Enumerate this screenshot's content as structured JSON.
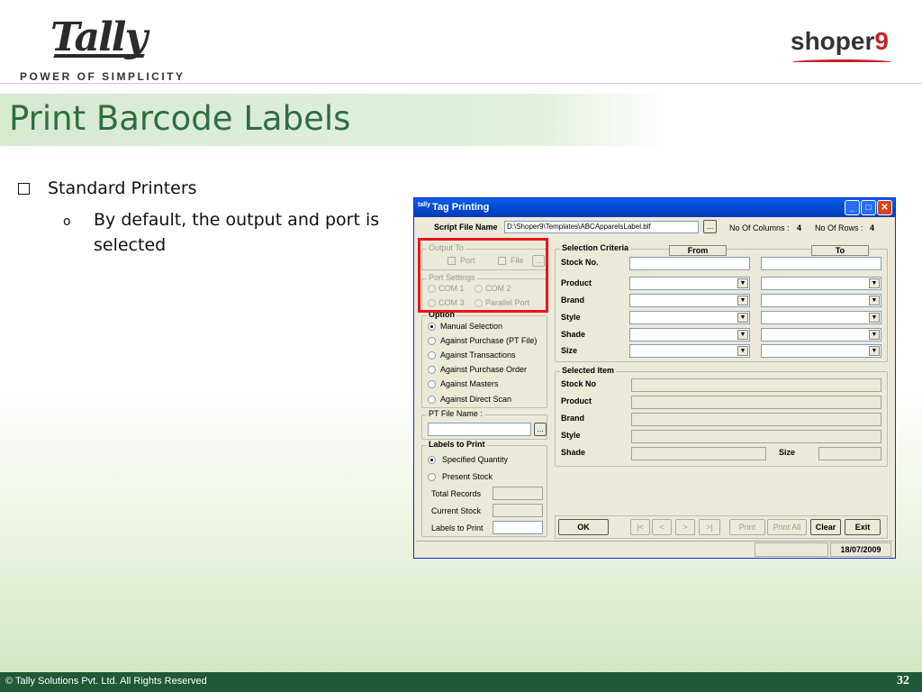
{
  "header": {
    "brand_tagline": "POWER OF SIMPLICITY",
    "page_title": "Print Barcode Labels",
    "colors": {
      "title": "#2e6e43",
      "footer_bg": "#1f5937",
      "highlight": "#e8161b"
    }
  },
  "bullets": {
    "level1": "Standard Printers",
    "level2": "By default, the output and port is selected"
  },
  "footer": {
    "copyright": "© Tally Solutions Pvt. Ltd. All Rights Reserved",
    "page_number": "32"
  },
  "dialog": {
    "title": "Tag Printing",
    "title_icon_text": "tally",
    "script_label": "Script File Name",
    "script_value": "D:\\Shoper9\\Templates\\ABCApparelsLabel.blf",
    "browse_label": "...",
    "columns_label": "No Of Columns :",
    "columns_value": "4",
    "rows_label": "No Of Rows :",
    "rows_value": "4",
    "output_to": {
      "caption": "Output To",
      "port": "Port",
      "file": "File"
    },
    "port_settings": {
      "caption": "Port Settings",
      "com1": "COM 1",
      "com2": "COM 2",
      "com3": "COM 3",
      "parallel": "Parallel Port"
    },
    "option": {
      "caption": "Option",
      "items": [
        "Manual Selection",
        "Against Purchase (PT File)",
        "Against Transactions",
        "Against Purchase Order",
        "Against Masters",
        "Against Direct Scan"
      ],
      "selected": "Manual Selection"
    },
    "pt_file_label": "PT File Name :",
    "labels_to_print": {
      "caption": "Labels to Print",
      "specified": "Specified Quantity",
      "present": "Present Stock",
      "total_records": "Total Records",
      "current_stock": "Current Stock",
      "labels_to_print": "Labels to Print"
    },
    "selection": {
      "caption": "Selection Criteria",
      "from": "From",
      "to": "To",
      "stock_no": "Stock No.",
      "product": "Product",
      "brand": "Brand",
      "style": "Style",
      "shade": "Shade",
      "size": "Size"
    },
    "selected_item": {
      "caption": "Selected Item",
      "stock_no": "Stock No",
      "product": "Product",
      "brand": "Brand",
      "style": "Style",
      "shade": "Shade",
      "size": "Size"
    },
    "buttons": {
      "ok": "OK",
      "first": "|<",
      "prev": "<",
      "next": ">",
      "last": ">|",
      "print": "Print",
      "print_all": "Print All",
      "clear": "Clear",
      "exit": "Exit"
    },
    "status_date": "18/07/2009"
  }
}
